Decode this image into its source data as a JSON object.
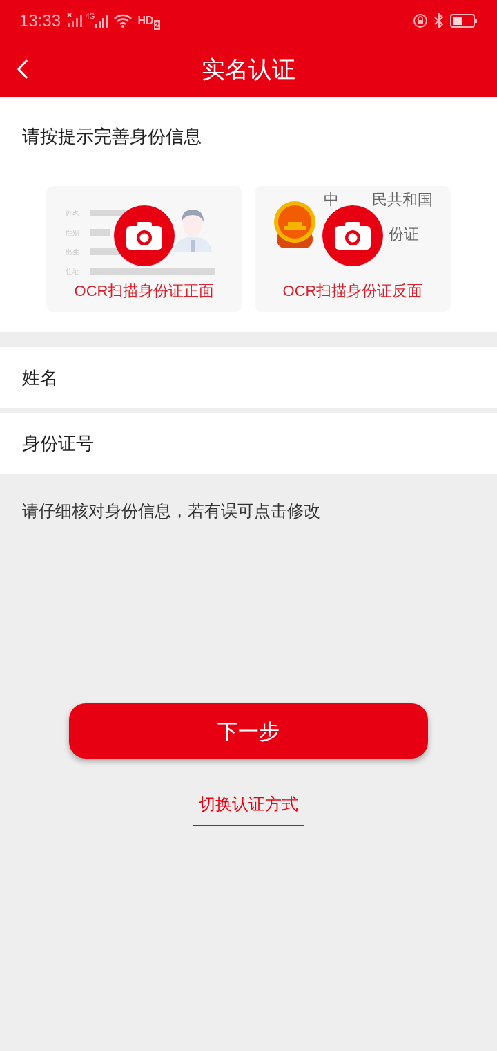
{
  "status_bar": {
    "time": "13:33",
    "network": "4G",
    "hd": "HD",
    "hd_sim": "2"
  },
  "header": {
    "title": "实名认证"
  },
  "section_title": "请按提示完善身份信息",
  "id_cards": [
    {
      "kind": "front",
      "labels": [
        "姓名",
        "性别",
        "出生",
        "住址"
      ],
      "caption": "OCR扫描身份证正面"
    },
    {
      "kind": "back",
      "heading_parts": [
        "中",
        "民共和国"
      ],
      "subheading_parts": [
        "份证"
      ],
      "caption": "OCR扫描身份证反面"
    }
  ],
  "fields": [
    {
      "label": "姓名"
    },
    {
      "label": "身份证号"
    }
  ],
  "note": "请仔细核对身份信息，若有误可点击修改",
  "next_button": "下一步",
  "switch_link": "切换认证方式"
}
